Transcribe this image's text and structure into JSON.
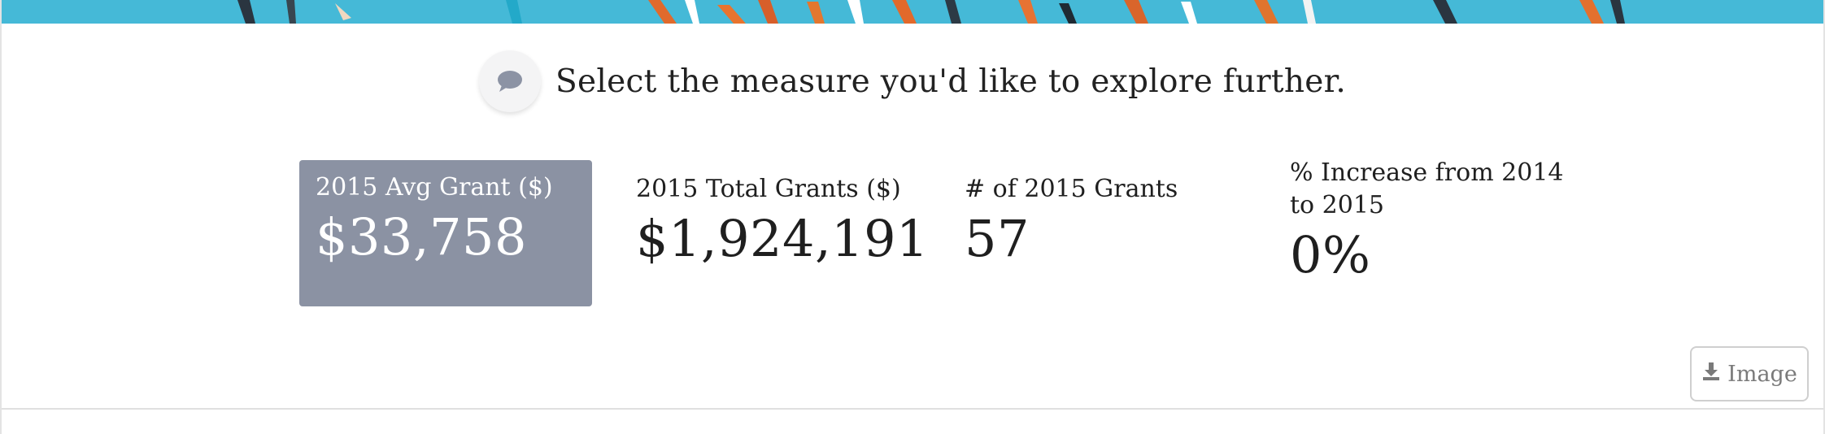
{
  "prompt": {
    "icon": "speech-bubble-icon",
    "text": "Select the measure you'd like to explore further."
  },
  "measures": [
    {
      "label": "2015 Avg Grant ($)",
      "value": "$33,758",
      "selected": true
    },
    {
      "label": "2015 Total Grants ($)",
      "value": "$1,924,191",
      "selected": false
    },
    {
      "label": "# of 2015 Grants",
      "value": "57",
      "selected": false
    },
    {
      "label": "% Increase from 2014 to 2015",
      "value": "0%",
      "selected": false
    }
  ],
  "export": {
    "icon": "download-icon",
    "label": "Image"
  },
  "colors": {
    "banner": "#44b8d6",
    "selected_bg": "#8b92a3",
    "text": "#1f1f1f",
    "muted": "#7a7a7a"
  }
}
